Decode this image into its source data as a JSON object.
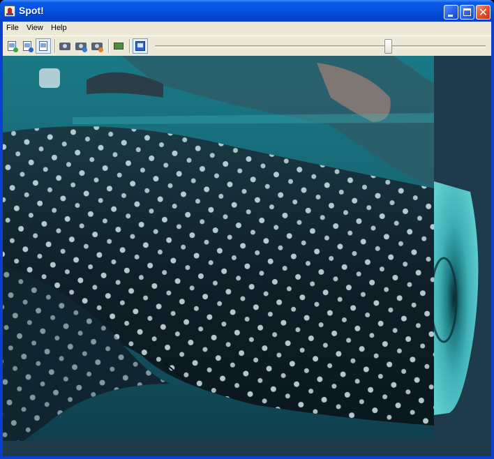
{
  "window": {
    "title": "Spot!"
  },
  "menu": {
    "items": [
      "File",
      "View",
      "Help"
    ]
  },
  "toolbar": {
    "buttons": [
      {
        "name": "new-image-icon"
      },
      {
        "name": "open-image-icon"
      },
      {
        "name": "select-region-icon"
      },
      {
        "name": "camera-icon"
      },
      {
        "name": "camera-settings-icon"
      },
      {
        "name": "camera-edit-icon"
      },
      {
        "name": "image-stack-icon"
      },
      {
        "name": "fullscreen-icon"
      }
    ],
    "slider": {
      "value": 0.71
    }
  },
  "colors": {
    "titlebar": "#0553e0",
    "chrome": "#ece9d8",
    "canvas_bg": "#1f3a4b",
    "water": "#1d6b78",
    "cylinder": "#4fc3c8"
  },
  "canvas": {
    "content": "whale-shark-texture-on-cylinder"
  }
}
